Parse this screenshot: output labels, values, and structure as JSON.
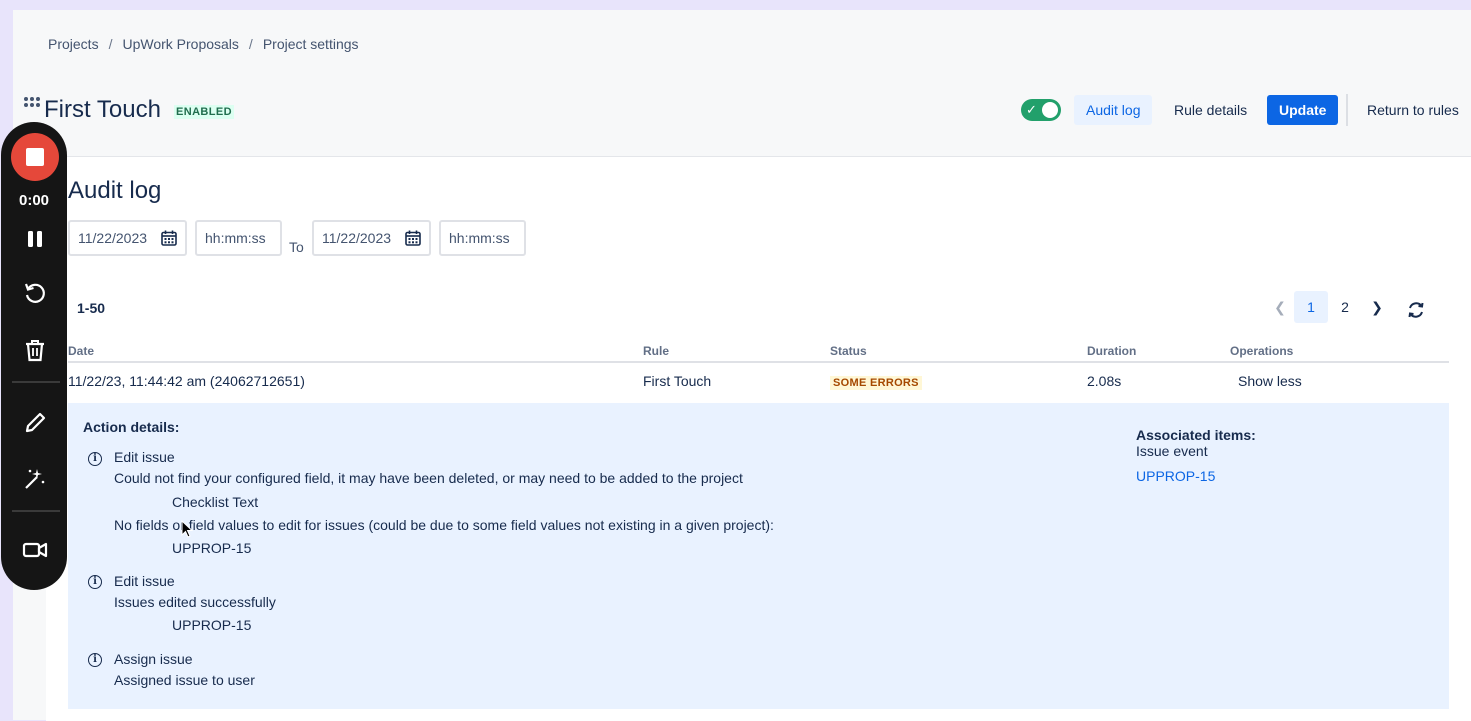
{
  "breadcrumb": [
    "Projects",
    "UpWork Proposals",
    "Project settings"
  ],
  "breadcrumb_separator": "/",
  "rule": {
    "title": "First Touch",
    "status": "ENABLED",
    "enabled": true
  },
  "header_actions": {
    "audit_log": "Audit log",
    "rule_details": "Rule details",
    "update": "Update",
    "return": "Return to rules"
  },
  "audit": {
    "title": "Audit log",
    "from_date": "11/22/2023",
    "from_time_placeholder": "hh:mm:ss",
    "to_label": "To",
    "to_date": "11/22/2023",
    "to_time_placeholder": "hh:mm:ss",
    "range": "1-50",
    "pagination": {
      "current": "1",
      "pages": [
        "1",
        "2"
      ]
    }
  },
  "table": {
    "headers": {
      "date": "Date",
      "rule": "Rule",
      "status": "Status",
      "duration": "Duration",
      "operations": "Operations"
    },
    "row": {
      "date": "11/22/23, 11:44:42 am (24062712651)",
      "rule": "First Touch",
      "status": "SOME ERRORS",
      "duration": "2.08s",
      "operation": "Show less"
    }
  },
  "details": {
    "title": "Action details:",
    "actions": [
      {
        "name": "Edit issue",
        "lines": [
          "Could not find your configured field, it may have been deleted, or may need to be added to the project",
          "Checklist Text",
          "No fields or field values to edit for issues (could be due to some field values not existing in a given project):",
          "UPPROP-15"
        ]
      },
      {
        "name": "Edit issue",
        "lines": [
          "Issues edited successfully",
          "UPPROP-15"
        ]
      },
      {
        "name": "Assign issue",
        "lines": [
          "Assigned issue to user"
        ]
      }
    ],
    "associated": {
      "title": "Associated items:",
      "subtitle": "Issue event",
      "link": "UPPROP-15"
    }
  },
  "recorder": {
    "time": "0:00"
  },
  "colors": {
    "accent": "#0c66e4",
    "toggle_on": "#22a06b",
    "record": "#e5483a",
    "details_bg": "#e9f2ff"
  },
  "icons": [
    "grid-icon",
    "check-icon",
    "calendar-icon",
    "chevron-left-icon",
    "chevron-right-icon",
    "refresh-icon",
    "info-icon",
    "stop-icon",
    "pause-icon",
    "restart-icon",
    "trash-icon",
    "pencil-icon",
    "magic-wand-icon",
    "camera-icon",
    "cursor-icon"
  ]
}
